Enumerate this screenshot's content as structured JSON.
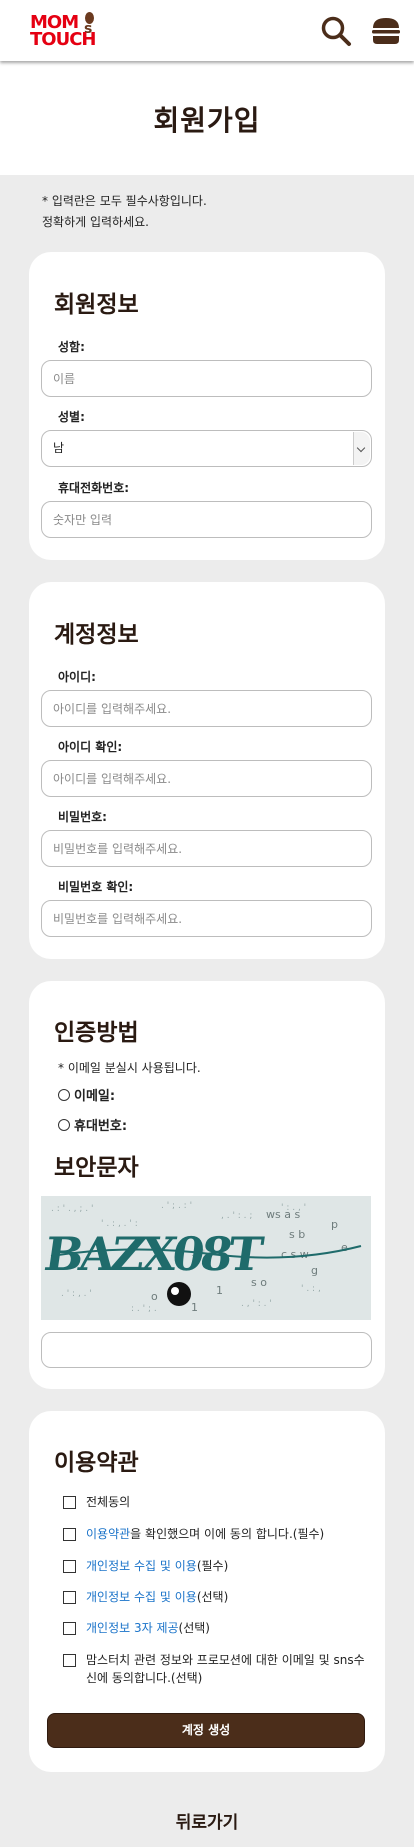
{
  "header": {
    "logo_line1": "MOM",
    "logo_line2": "TOUCH",
    "logo_s": "s",
    "search_icon": "search-icon",
    "menu_icon": "burger-menu-icon",
    "brand_red": "#e50012",
    "brand_brown": "#6b3a1f"
  },
  "page": {
    "title": "회원가입",
    "notice_line1": "* 입력란은 모두 필수사항입니다.",
    "notice_line2": "정확하게 입력하세요.",
    "back_label": "뒤로가기"
  },
  "member_info": {
    "title": "회원정보",
    "name_label": "성함:",
    "name_placeholder": "이름",
    "gender_label": "성별:",
    "gender_value": "남",
    "phone_label": "휴대전화번호:",
    "phone_placeholder": "숫자만 입력"
  },
  "account_info": {
    "title": "계정정보",
    "id_label": "아이디:",
    "id_placeholder": "아이디를 입력해주세요.",
    "id_confirm_label": "아이디 확인:",
    "id_confirm_placeholder": "아이디를 입력해주세요.",
    "pw_label": "비밀번호:",
    "pw_placeholder": "비밀번호를 입력해주세요.",
    "pw_confirm_label": "비밀번호 확인:",
    "pw_confirm_placeholder": "비밀번호를 입력해주세요."
  },
  "auth": {
    "title": "인증방법",
    "note": "* 이메일 분실시 사용됩니다.",
    "option_email": "이메일:",
    "option_phone": "휴대번호:",
    "captcha_title": "보안문자",
    "captcha_text": "BAZX08T",
    "captcha_input_value": ""
  },
  "terms": {
    "title": "이용약관",
    "all_agree": "전체동의",
    "t1_link": "이용약관",
    "t1_rest": "을 확인했으며 이에 동의 합니다.(필수)",
    "t2_link": "개인정보 수집 및 이용",
    "t2_rest": "(필수)",
    "t3_link": "개인정보 수집 및 이용",
    "t3_rest": "(선택)",
    "t4_link": "개인정보 3자 제공",
    "t4_rest": "(선택)",
    "t5_text": "맘스터치 관련 정보와 프로모션에 대한 이메일 및 sns수신에 동의합니다.(선택)",
    "submit_label": "계정 생성",
    "link_color": "#1a73c9",
    "button_color": "#4b2d1a"
  }
}
